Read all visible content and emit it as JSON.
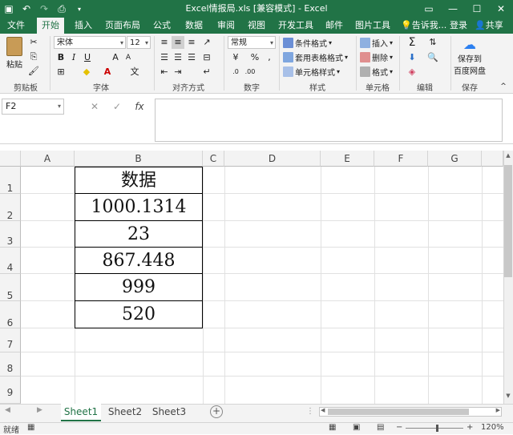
{
  "window": {
    "title": "Excel情报局.xls  [兼容模式] - Excel",
    "controls": [
      "▭",
      "—",
      "☐",
      "✕"
    ]
  },
  "qat": {
    "save": "💾",
    "undo": "↶",
    "redo": "↷",
    "preview": "🔍"
  },
  "tabs": [
    "文件",
    "开始",
    "插入",
    "页面布局",
    "公式",
    "数据",
    "审阅",
    "视图",
    "开发工具",
    "邮件",
    "图片工具"
  ],
  "active_tab": "开始",
  "tellme": "告诉我...",
  "login": "登录",
  "share": "共享",
  "ribbon": {
    "clipboard": {
      "paste": "粘贴",
      "label": "剪贴板"
    },
    "font": {
      "name": "宋体",
      "size": "12",
      "label": "字体",
      "bold": "B",
      "italic": "I",
      "underline": "U",
      "grow": "A",
      "shrink": "A"
    },
    "align": {
      "label": "对齐方式"
    },
    "number": {
      "format": "常规",
      "label": "数字",
      "percent": "%"
    },
    "styles": {
      "cond": "条件格式",
      "table": "套用表格格式",
      "cell": "单元格样式",
      "label": "样式"
    },
    "cells": {
      "insert": "插入",
      "delete": "删除",
      "format": "格式",
      "label": "单元格"
    },
    "edit": {
      "label": "编辑"
    },
    "save": {
      "line1": "保存到",
      "line2": "百度网盘",
      "label": "保存"
    }
  },
  "formula": {
    "namebox": "F2",
    "cancel": "✕",
    "enter": "✓",
    "fx": "fx",
    "value": ""
  },
  "columns": [
    "A",
    "B",
    "C",
    "D",
    "E",
    "F",
    "G"
  ],
  "rows": [
    "1",
    "2",
    "3",
    "4",
    "5",
    "6",
    "7",
    "8",
    "9"
  ],
  "cells": {
    "B1": "数据",
    "B2": "1000.1314",
    "B3": "23",
    "B4": "867.448",
    "B5": "999",
    "B6": "520"
  },
  "sheets": [
    "Sheet1",
    "Sheet2",
    "Sheet3"
  ],
  "active_sheet": "Sheet1",
  "status": {
    "ready": "就绪",
    "zoom": "120%"
  },
  "accent": "#217346"
}
